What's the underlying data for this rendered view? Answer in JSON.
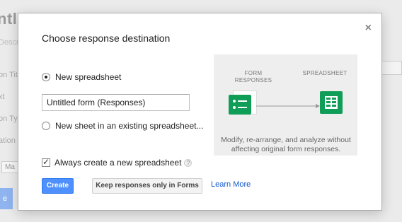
{
  "background": {
    "title_fragment": "ntled",
    "desc_fragment": "Descr",
    "labels": [
      "on Tit",
      "xt",
      "on Typ",
      "ation"
    ],
    "small_button": "Ma",
    "blue_fragment": "e"
  },
  "dialog": {
    "title": "Choose response destination",
    "close_glyph": "×",
    "options": {
      "new_spreadsheet": "New spreadsheet",
      "existing_sheet": "New sheet in an existing spreadsheet..."
    },
    "spreadsheet_name": "Untitled form (Responses)",
    "always_create_label": "Always create a new spreadsheet",
    "help_glyph": "?",
    "buttons": {
      "create": "Create",
      "keep": "Keep responses only in Forms"
    },
    "learn_more": "Learn More",
    "illustration": {
      "form_label_line1": "FORM",
      "form_label_line2": "RESPONSES",
      "sheet_label": "SPREADSHEET",
      "caption_line1": "Modify, re-arrange, and analyze without",
      "caption_line2": "affecting original form responses."
    }
  },
  "colors": {
    "primary_button": "#4d90fe",
    "link": "#1155cc",
    "sheets_green": "#0f9d58"
  }
}
